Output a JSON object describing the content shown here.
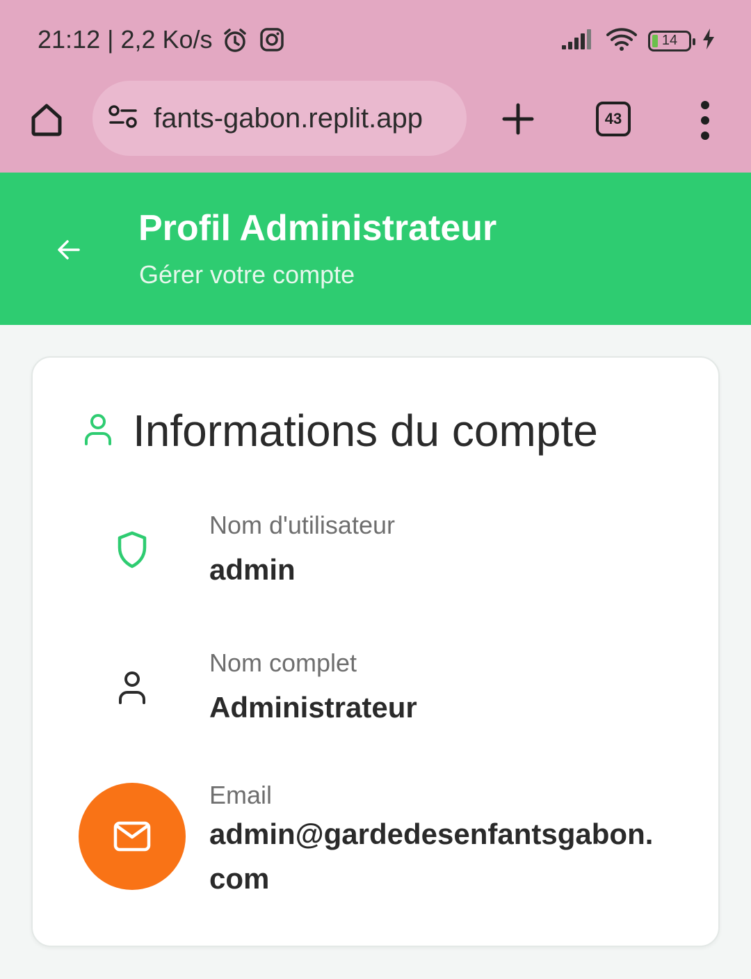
{
  "status_bar": {
    "time_speed": "21:12 | 2,2 Ko/s",
    "battery_level": "14",
    "icons": [
      "alarm-icon",
      "instagram-icon",
      "signal-icon",
      "wifi-icon",
      "battery-icon",
      "charging-icon"
    ]
  },
  "browser": {
    "url": "fants-gabon.replit.app",
    "tab_count": "43",
    "icons": [
      "home-icon",
      "site-settings-icon",
      "new-tab-icon",
      "more-menu-icon"
    ]
  },
  "header": {
    "title": "Profil Administrateur",
    "subtitle": "Gérer votre compte",
    "background": "#2ecc71"
  },
  "card": {
    "title": "Informations du compte",
    "fields": [
      {
        "label": "Nom d'utilisateur",
        "value": "admin",
        "icon": "shield-icon"
      },
      {
        "label": "Nom complet",
        "value": "Administrateur",
        "icon": "user-icon"
      },
      {
        "label": "Email",
        "value": "admin@gardedesenfantsgabon.com",
        "icon": "mail-icon"
      }
    ]
  },
  "colors": {
    "accent_green": "#2ecc71",
    "email_button_orange": "#f97316",
    "browser_chrome": "#e3a8c2"
  }
}
